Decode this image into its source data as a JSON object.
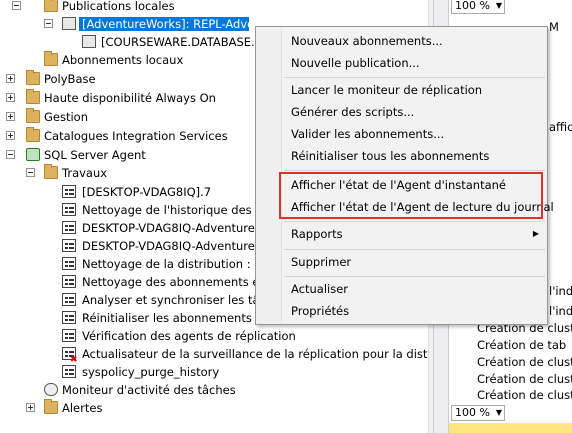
{
  "tree": {
    "publications_locales": "Publications locales",
    "publication": "[AdventureWorks]: REPL-AdventureWorks",
    "courseware": "[COURSEWARE.DATABASE.W",
    "abonnements_locaux": "Abonnements locaux",
    "polybase": "PolyBase",
    "haute_dispo": "Haute disponibilité Always On",
    "gestion": "Gestion",
    "catalogues": "Catalogues Integration Services",
    "sql_agent": "SQL Server Agent",
    "travaux": "Travaux",
    "jobs": [
      "[DESKTOP-VDAG8IQ].7",
      "Nettoyage de l'historique des ag",
      "DESKTOP-VDAG8IQ-AdventureW",
      "DESKTOP-VDAG8IQ-AdventureW",
      "Nettoyage de la distribution : dist",
      "Nettoyage des abonnements exp",
      "Analyser et synchroniser les tâche",
      "Réinitialiser les abonnements en cas d'échec de la validation des donn",
      "Vérification des agents de réplication",
      "Actualisateur de la surveillance de la réplication pour la distribution.",
      "syspolicy_purge_history"
    ],
    "moniteur": "Moniteur d'activité des tâches",
    "alertes": "Alertes"
  },
  "menu": {
    "items": [
      "Nouveaux abonnements...",
      "Nouvelle publication...",
      "Lancer le moniteur de réplication",
      "Générer des scripts...",
      "Valider les abonnements...",
      "Réinitialiser tous les abonnements",
      "Afficher l'état de l'Agent d'instantané",
      "Afficher l'état de l'Agent de lecture du journal",
      "Rapports",
      "Supprimer",
      "Actualiser",
      "Propriétés"
    ],
    "submenu_arrow": "▶"
  },
  "right": {
    "zoom_top": "100 %",
    "zoom_bottom": "100 %",
    "lines": [
      "Création de tab",
      "Création de tab",
      "Création de clust",
      "Création de tab",
      "Création de clust",
      "Création de clust",
      "Création de tab",
      "Création de clust",
      "Création de clust",
      "Création de tab",
      "Création de clust"
    ],
    "fragments": [
      "M",
      "afficl",
      "l'inde",
      "l'inde",
      "l'ind",
      "l'ind",
      "l'ind"
    ]
  },
  "colors": {
    "selection": "#0078d7",
    "highlight_box": "#e03030",
    "menu_bg": "#f2f2f2"
  }
}
